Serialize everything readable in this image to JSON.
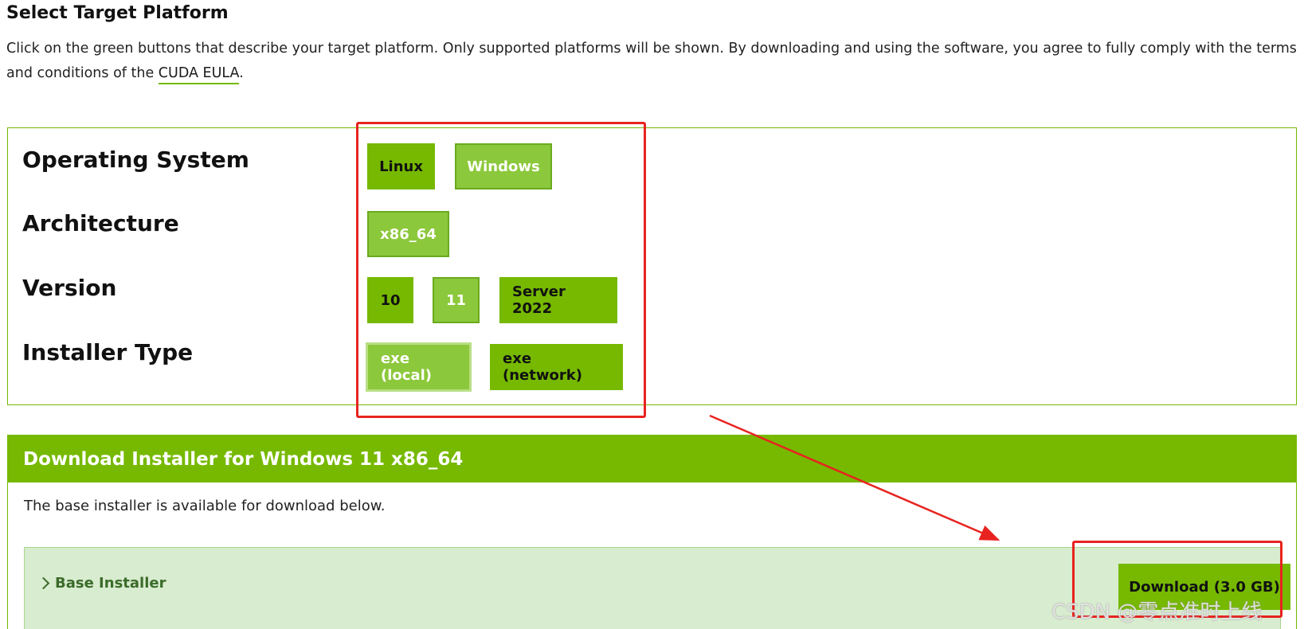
{
  "page": {
    "title": "Select Target Platform",
    "intro_text": "Click on the green buttons that describe your target platform. Only supported platforms will be shown. By downloading and using the software, you agree to fully comply with the terms and conditions of the ",
    "eula_link": "CUDA EULA",
    "intro_suffix": "."
  },
  "selector": {
    "rows": [
      {
        "label": "Operating System",
        "options": [
          "Linux",
          "Windows"
        ],
        "selected": "Windows"
      },
      {
        "label": "Architecture",
        "options": [
          "x86_64"
        ],
        "selected": "x86_64"
      },
      {
        "label": "Version",
        "options": [
          "10",
          "11",
          "Server 2022"
        ],
        "selected": "11"
      },
      {
        "label": "Installer Type",
        "options": [
          "exe (local)",
          "exe (network)"
        ],
        "selected": "exe (local)"
      }
    ]
  },
  "download": {
    "header": "Download Installer for Windows 11 x86_64",
    "note": "The base installer is available for download below.",
    "base_installer_label": "Base Installer",
    "download_button": "Download (3.0 GB)"
  },
  "watermark": "CSDN @零点准时上线",
  "colors": {
    "nvidia_green": "#76b900",
    "selected_green": "#8cc83b",
    "annotation_red": "#e8231f",
    "base_installer_bg": "#d8ecd0"
  },
  "icons": {
    "expand": "chevron-right-icon"
  }
}
